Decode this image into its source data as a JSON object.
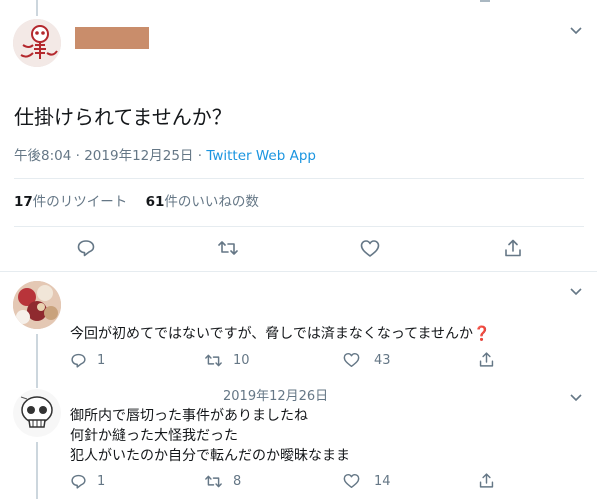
{
  "main_tweet": {
    "author_name_redacted_color": "#c98d6b",
    "text": "仕掛けられてませんか？",
    "time": "午後8:04",
    "separator": "·",
    "date": "2019年12月25日",
    "separator2": "·",
    "source": "Twitter Web App",
    "retweets_count": "17",
    "retweets_label": "件のリツイート",
    "likes_count": "61",
    "likes_label": "件のいいねの数"
  },
  "replies": [
    {
      "text": "今回が初めてではないですが、脅しでは済まなくなってませんか",
      "emoji": "❓",
      "reply_count": "1",
      "retweet_count": "10",
      "like_count": "43"
    },
    {
      "date": "2019年12月26日",
      "lines": [
        "御所内で唇切った事件がありましたね",
        "何針か縫った大怪我だった",
        "犯人がいたのか自分で転んだのか曖昧なまま"
      ],
      "reply_count": "1",
      "retweet_count": "8",
      "like_count": "14"
    }
  ],
  "icons": [
    "caret-down-icon",
    "reply-icon",
    "retweet-icon",
    "like-icon",
    "share-icon"
  ],
  "colors": {
    "accent": "#1b95e0",
    "muted": "#657786",
    "border": "#e6ecf0",
    "emoji_red": "#dd2e44"
  }
}
